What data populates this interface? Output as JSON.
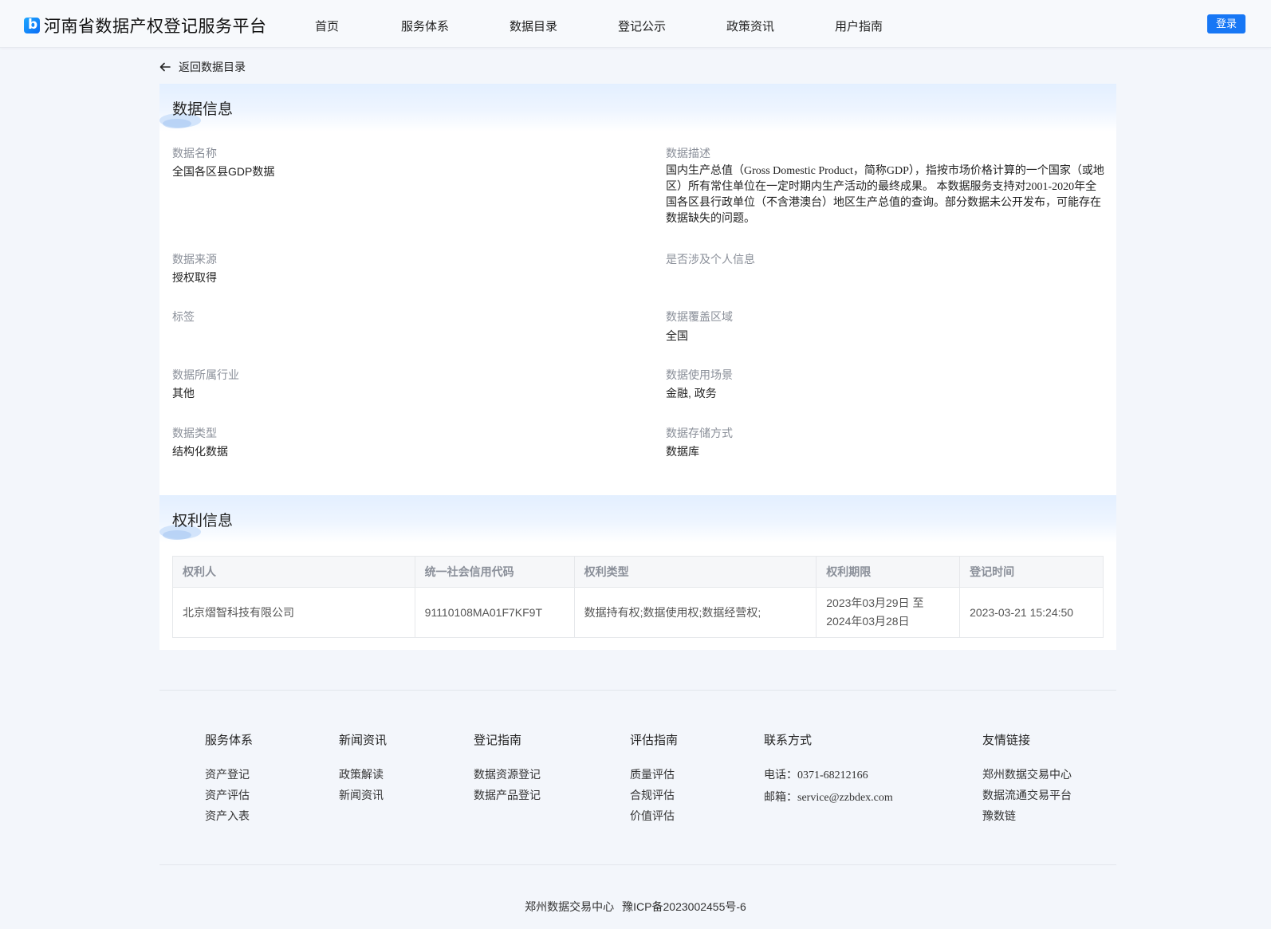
{
  "header": {
    "site_title": "河南省数据产权登记服务平台",
    "nav": [
      "首页",
      "服务体系",
      "数据目录",
      "登记公示",
      "政策资讯",
      "用户指南"
    ],
    "login_label": "登录"
  },
  "back_link": {
    "label": "返回数据目录"
  },
  "data_info": {
    "title": "数据信息",
    "fields": {
      "name": {
        "label": "数据名称",
        "value": "全国各区县GDP数据"
      },
      "description": {
        "label": "数据描述",
        "value": "国内生产总值（Gross Domestic Product，简称GDP），指按市场价格计算的一个国家（或地区）所有常住单位在一定时期内生产活动的最终成果。 本数据服务支持对2001-2020年全国各区县行政单位（不含港澳台）地区生产总值的查询。部分数据未公开发布，可能存在数据缺失的问题。"
      },
      "source": {
        "label": "数据来源",
        "value": "授权取得"
      },
      "personal_info": {
        "label": "是否涉及个人信息",
        "value": ""
      },
      "tags": {
        "label": "标签",
        "value": ""
      },
      "coverage": {
        "label": "数据覆盖区域",
        "value": "全国"
      },
      "industry": {
        "label": "数据所属行业",
        "value": "其他"
      },
      "scenario": {
        "label": "数据使用场景",
        "value": "金融, 政务"
      },
      "type": {
        "label": "数据类型",
        "value": "结构化数据"
      },
      "storage": {
        "label": "数据存储方式",
        "value": "数据库"
      }
    }
  },
  "rights_info": {
    "title": "权利信息",
    "columns": [
      "权利人",
      "统一社会信用代码",
      "权利类型",
      "权利期限",
      "登记时间"
    ],
    "rows": [
      {
        "holder": "北京熠智科技有限公司",
        "credit_code": "91110108MA01F7KF9T",
        "right_type": "数据持有权;数据使用权;数据经营权;",
        "period_line1": "2023年03月29日 至",
        "period_line2": "2024年03月28日",
        "registered_at": "2023-03-21 15:24:50"
      }
    ]
  },
  "footer": {
    "columns": [
      {
        "title": "服务体系",
        "items": [
          "资产登记",
          "资产评估",
          "资产入表"
        ]
      },
      {
        "title": "新闻资讯",
        "items": [
          "政策解读",
          "新闻资讯"
        ]
      },
      {
        "title": "登记指南",
        "items": [
          "数据资源登记",
          "数据产品登记"
        ]
      },
      {
        "title": "评估指南",
        "items": [
          "质量评估",
          "合规评估",
          "价值评估"
        ]
      },
      {
        "title": "联系方式",
        "phone_label": "电话：",
        "phone": "0371-68212166",
        "email_label": "邮箱：",
        "email": "service@zzbdex.com"
      },
      {
        "title": "友情链接",
        "items": [
          "郑州数据交易中心",
          "数据流通交易平台",
          "豫数链"
        ]
      }
    ],
    "copyright": {
      "org": "郑州数据交易中心",
      "icp": "豫ICP备2023002455号-6"
    }
  },
  "colors": {
    "primary": "#1777f5",
    "label_gray": "#8a8f99",
    "page_bg": "#f3f6fb"
  }
}
